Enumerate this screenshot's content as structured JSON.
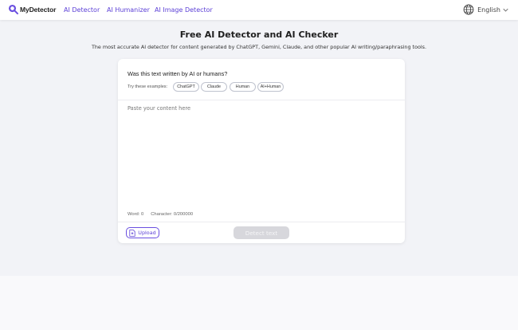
{
  "header": {
    "logo_text": "MyDetector",
    "nav": [
      "AI Detector",
      "AI Humanizer",
      "AI Image Detector"
    ],
    "language": "English"
  },
  "hero": {
    "title": "Free AI Detector and AI Checker",
    "subtitle": "The most accurate AI detector for content generated by ChatGPT, Gemini, Claude, and other popular AI writing/paraphrasing tools."
  },
  "card": {
    "question": "Was this text written by AI or humans?",
    "examples_label": "Try these examples:",
    "examples": [
      "ChatGPT",
      "Claude",
      "Human",
      "AI+Human"
    ],
    "placeholder": "Paste your content here",
    "word_count": "Word: 0",
    "char_count": "Character: 0/200000",
    "upload_label": "Upload",
    "detect_label": "Detect text"
  },
  "colors": {
    "brand": "#5b3fd6",
    "detect_disabled": "#d7d7dc"
  },
  "icons": {
    "logo": "magnifier-logo-icon",
    "language": "globe-icon",
    "dropdown": "chevron-down-icon",
    "upload": "document-upload-icon"
  }
}
